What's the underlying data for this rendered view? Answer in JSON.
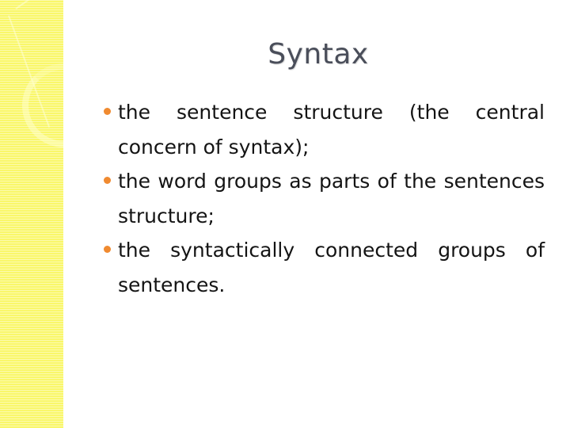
{
  "slide": {
    "title": "Syntax",
    "bullets": [
      {
        "text": "the sentence structure (the central concern of syntax);"
      },
      {
        "text": "the word groups as parts of the sentences structure;"
      },
      {
        "text": "the syntactically connected groups of sentences."
      }
    ],
    "colors": {
      "side_strip": "#f9f76a",
      "bullet": "#f08a30",
      "title": "#4a4e5a",
      "body_text": "#141414"
    },
    "icons": {
      "bullet": "orange-dot-icon"
    }
  }
}
